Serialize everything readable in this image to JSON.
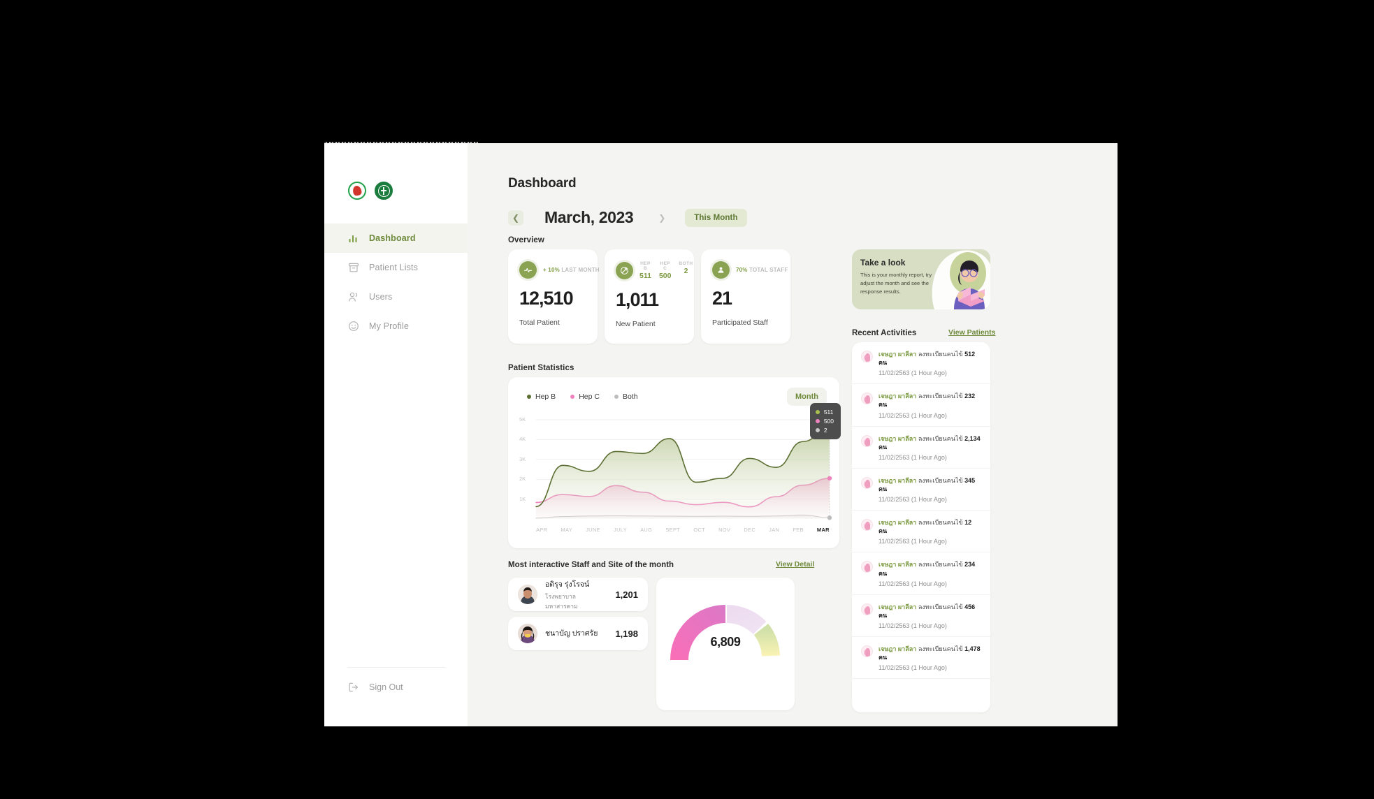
{
  "app": {
    "sidebar": {
      "logos": [
        "thai-redcross-logo",
        "ministry-public-health-logo"
      ],
      "items": [
        {
          "label": "Dashboard",
          "icon": "bar-chart-icon",
          "active": true
        },
        {
          "label": "Patient Lists",
          "icon": "archive-box-icon",
          "active": false
        },
        {
          "label": "Users",
          "icon": "users-icon",
          "active": false
        },
        {
          "label": "My Profile",
          "icon": "smiley-face-icon",
          "active": false
        }
      ],
      "sign_out": "Sign Out",
      "sign_out_icon": "logout-arrow-icon"
    },
    "header": {
      "page_title": "Dashboard",
      "month_title": "March, 2023",
      "prev_icon": "chevron-left-icon",
      "next_icon": "chevron-right-icon",
      "this_month_label": "This Month"
    },
    "overview": {
      "section_label": "Overview",
      "cards": [
        {
          "icon": "pulse-activity-icon",
          "delta": "+ 10%",
          "delta_caption": "LAST MONTH",
          "value": "12,510",
          "caption": "Total Patient"
        },
        {
          "icon": "syringe-icon",
          "mini_table": {
            "headers": [
              "HEP B",
              "HEP C",
              "BOTH"
            ],
            "values": [
              "511",
              "500",
              "2"
            ]
          },
          "value": "1,011",
          "caption": "New Patient"
        },
        {
          "icon": "person-icon",
          "delta": "70%",
          "delta_caption": "TOTAL STAFF",
          "value": "21",
          "caption": "Participated Staff"
        }
      ]
    },
    "promo": {
      "title": "Take a look",
      "body": "This is your monthly report, try adjust the month and see the response results.",
      "illustration": "woman-reading-book-illustration"
    },
    "recent_activities": {
      "heading": "Recent Activities",
      "view_link": "View Patients",
      "items": [
        {
          "user": "เจษฎา ผาลีลา",
          "action": "ลงทะเบียนคนไข้",
          "count": "512 คน",
          "time": "11/02/2563 (1 Hour Ago)"
        },
        {
          "user": "เจษฎา ผาลีลา",
          "action": "ลงทะเบียนคนไข้",
          "count": "232 คน",
          "time": "11/02/2563 (1 Hour Ago)"
        },
        {
          "user": "เจษฎา ผาลีลา",
          "action": "ลงทะเบียนคนไข้",
          "count": "2,134 คน",
          "time": "11/02/2563 (1 Hour Ago)"
        },
        {
          "user": "เจษฎา ผาลีลา",
          "action": "ลงทะเบียนคนไข้",
          "count": "345 คน",
          "time": "11/02/2563 (1 Hour Ago)"
        },
        {
          "user": "เจษฎา ผาลีลา",
          "action": "ลงทะเบียนคนไข้",
          "count": "12 คน",
          "time": "11/02/2563 (1 Hour Ago)"
        },
        {
          "user": "เจษฎา ผาลีลา",
          "action": "ลงทะเบียนคนไข้",
          "count": "234 คน",
          "time": "11/02/2563 (1 Hour Ago)"
        },
        {
          "user": "เจษฎา ผาลีลา",
          "action": "ลงทะเบียนคนไข้",
          "count": "456 คน",
          "time": "11/02/2563 (1 Hour Ago)"
        },
        {
          "user": "เจษฎา ผาลีลา",
          "action": "ลงทะเบียนคนไข้",
          "count": "1,478 คน",
          "time": "11/02/2563 (1 Hour Ago)"
        }
      ]
    },
    "patient_statistics": {
      "section_label": "Patient Statistics",
      "range_button": "Month",
      "tooltip": [
        {
          "color": "#7d9b42",
          "value": "511"
        },
        {
          "color": "#ef83bd",
          "value": "500"
        },
        {
          "color": "#bdbdbd",
          "value": "2"
        }
      ]
    },
    "most_interactive": {
      "heading": "Most interactive Staff and Site of the month",
      "view_link": "View Detail",
      "staff": [
        {
          "name": "อติรุจ รุ่งโรจน์",
          "site": "โรงพยาบาลมหาสารคาม",
          "value": "1,201",
          "avatar": "male-portrait-avatar"
        },
        {
          "name": "ชนาบัญ ปราศรัย",
          "site": "",
          "value": "1,198",
          "avatar": "female-portrait-avatar"
        }
      ],
      "gauge": {
        "value": "6,809",
        "type": "donut-gauge"
      }
    },
    "colors": {
      "accent_green": "#7d9b42",
      "dark_green": "#5e7834",
      "pink": "#ef83bd",
      "grey": "#bdbdbd",
      "bg": "#f4f4f2",
      "card": "#ffffff"
    }
  },
  "chart_data": {
    "type": "area",
    "title": "Patient Statistics",
    "xlabel": "",
    "ylabel": "",
    "ylim": [
      0,
      5000
    ],
    "yticks": [
      "1K",
      "2K",
      "3K",
      "4K",
      "5K"
    ],
    "grid": true,
    "legend_position": "top-left",
    "categories": [
      "APR",
      "MAY",
      "JUNE",
      "JULY",
      "AUG",
      "SEPT",
      "OCT",
      "NOV",
      "DEC",
      "JAN",
      "FEB",
      "MAR"
    ],
    "series": [
      {
        "name": "Hep B",
        "color": "#5c6f32",
        "values": [
          620,
          2700,
          2400,
          3400,
          3300,
          4050,
          1850,
          2050,
          3050,
          2600,
          3900,
          4600
        ]
      },
      {
        "name": "Hep C",
        "color": "#ef83bd",
        "values": [
          830,
          1230,
          1130,
          1680,
          1350,
          900,
          720,
          840,
          610,
          1120,
          1700,
          2050
        ]
      },
      {
        "name": "Both",
        "color": "#bdbdbd",
        "values": [
          40,
          120,
          150,
          160,
          150,
          140,
          130,
          140,
          130,
          150,
          200,
          60
        ]
      }
    ]
  }
}
